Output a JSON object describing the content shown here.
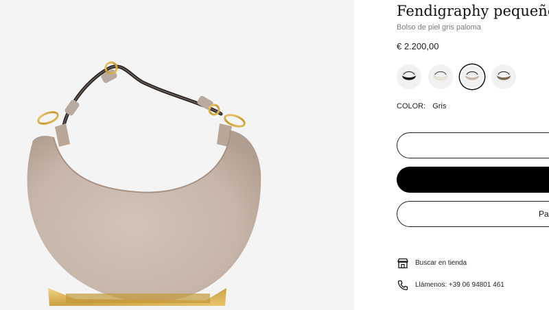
{
  "product": {
    "title": "Fendigraphy pequeño",
    "subtitle": "Bolso de piel gris paloma",
    "price": "€ 2.200,00"
  },
  "swatches": [
    {
      "name": "negro",
      "color": "#1c1c1c",
      "selected": false
    },
    {
      "name": "blanco",
      "color": "#ece7dd",
      "selected": false
    },
    {
      "name": "gris",
      "color": "#c7b7aa",
      "selected": true
    },
    {
      "name": "marron",
      "color": "#7a6a52",
      "selected": false
    }
  ],
  "color_selection": {
    "label": "COLOR:",
    "value": "Gris"
  },
  "buttons": {
    "button1_label": "",
    "button2_label": "",
    "button3_label": "Pa"
  },
  "links": {
    "store_label": "Buscar en tienda",
    "call_label": "Llámenos: +39 06 94801 461"
  },
  "colors": {
    "bag": "#c9b9ac",
    "hardware": "#d4aa4a",
    "strap": "#2a2522",
    "gallery_bg": "#f4f4f4"
  },
  "icons": [
    "store-icon",
    "phone-icon"
  ]
}
